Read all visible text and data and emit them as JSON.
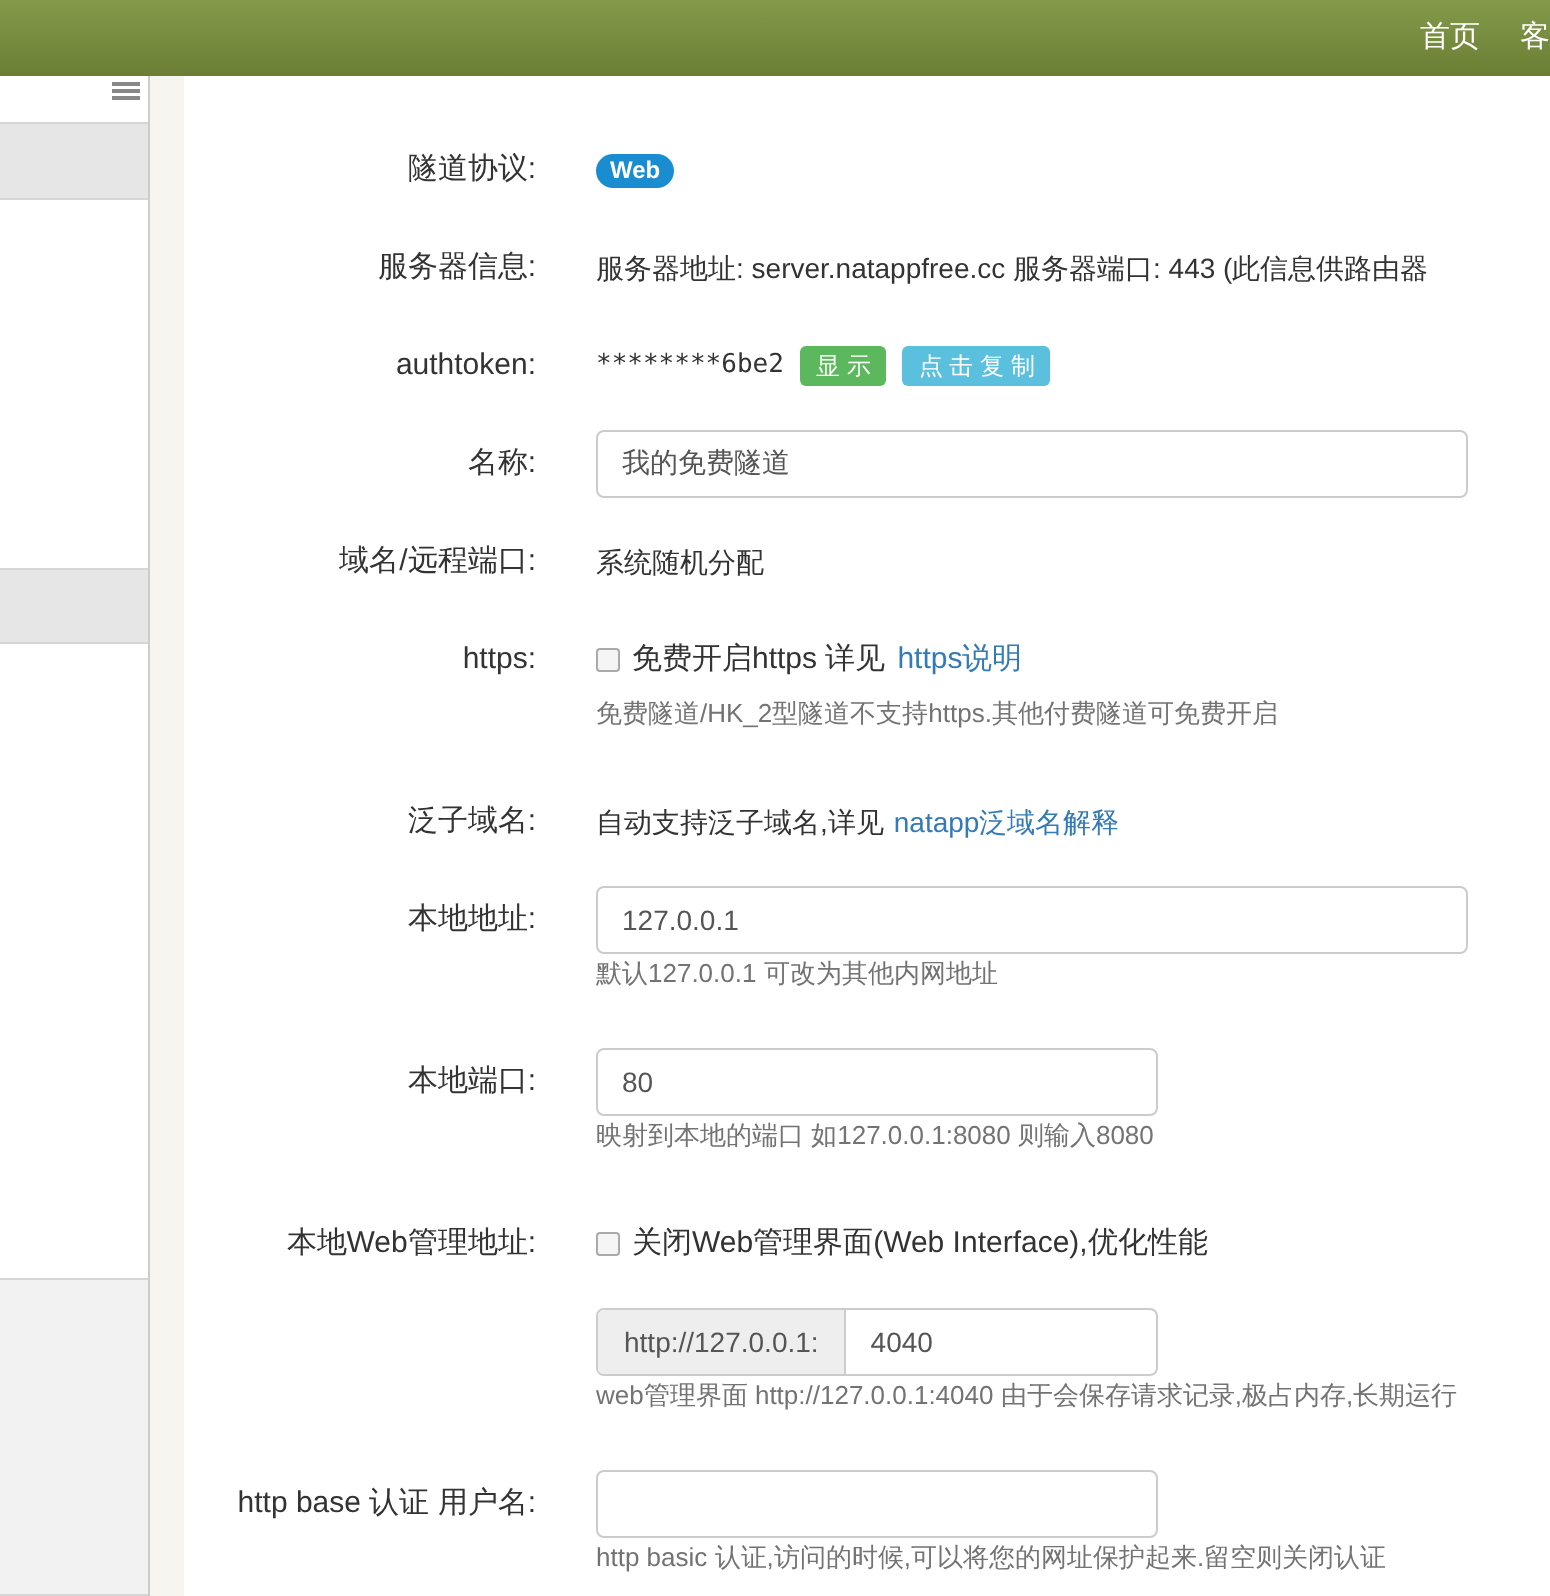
{
  "header": {
    "nav": [
      "首页",
      "客"
    ]
  },
  "sidebar": {
    "sections": [
      {
        "kind": "plain"
      },
      {
        "kind": "shaded"
      },
      {
        "kind": "plain"
      },
      {
        "kind": "shaded"
      },
      {
        "kind": "plain"
      },
      {
        "kind": "muted"
      }
    ]
  },
  "form": [
    {
      "label": "隧道协议:",
      "kind": "badge",
      "value": "Web"
    },
    {
      "label": "服务器信息:",
      "kind": "text",
      "value": "服务器地址: server.natappfree.cc 服务器端口: 443 (此信息供路由器"
    },
    {
      "label": "authtoken:",
      "kind": "token",
      "value": "********6be2",
      "buttons": [
        {
          "label": "显 示",
          "color": "#5cb85c"
        },
        {
          "label": "点 击 复 制",
          "color": "#5bc0de"
        }
      ]
    },
    {
      "label": "名称:",
      "kind": "input",
      "value": "我的免费隧道"
    },
    {
      "label": "域名/远程端口:",
      "kind": "text",
      "value": "系统随机分配"
    },
    {
      "label": "https:",
      "kind": "checkbox",
      "checked": false,
      "value": "免费开启https 详见",
      "link": "https说明",
      "hint": "免费隧道/HK_2型隧道不支持https.其他付费隧道可免费开启"
    },
    {
      "label": "泛子域名:",
      "kind": "text",
      "value": "自动支持泛子域名,详见",
      "link": "natapp泛域名解释"
    },
    {
      "label": "本地地址:",
      "kind": "input",
      "value": "127.0.0.1",
      "hint": "默认127.0.0.1 可改为其他内网地址"
    },
    {
      "label": "本地端口:",
      "kind": "short_input",
      "value": "80",
      "hint": "映射到本地的端口 如127.0.0.1:8080 则输入8080"
    },
    {
      "label": "本地Web管理地址:",
      "kind": "checkbox",
      "checked": false,
      "value": "关闭Web管理界面(Web Interface),优化性能"
    },
    {
      "kind": "input_group",
      "addon": "http://127.0.0.1:",
      "value": "4040",
      "hint": "web管理界面 http://127.0.0.1:4040 由于会保存请求记录,极占内存,长期运行"
    },
    {
      "label": "http base 认证 用户名:",
      "kind": "short_input",
      "hint": "http basic 认证,访问的时候,可以将您的网址保护起来.留空则关闭认证"
    }
  ]
}
